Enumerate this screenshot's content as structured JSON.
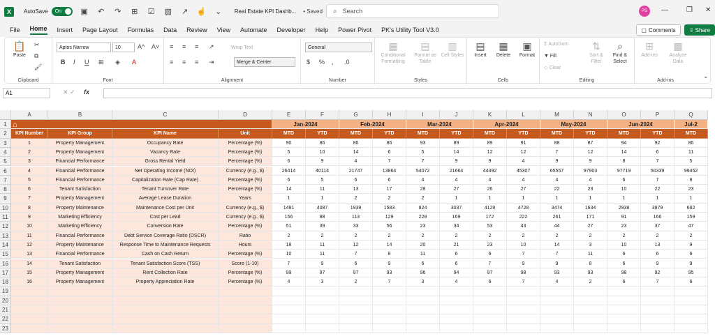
{
  "titlebar": {
    "autosave_label": "AutoSave",
    "autosave_state": "On",
    "file_title": "Real Estate KPI Dashb...",
    "saved_label": "• Saved",
    "search_placeholder": "Search",
    "avatar_initials": "PS"
  },
  "menu": {
    "items": [
      "File",
      "Home",
      "Insert",
      "Page Layout",
      "Formulas",
      "Data",
      "Review",
      "View",
      "Automate",
      "Developer",
      "Help",
      "Power Pivot",
      "PK's Utility Tool V3.0"
    ],
    "active": "Home",
    "comments_label": "Comments",
    "share_label": "Share"
  },
  "ribbon": {
    "clipboard": {
      "label": "Clipboard",
      "paste": "Paste"
    },
    "font": {
      "label": "Font",
      "name": "Aptos Narrow",
      "size": "10"
    },
    "alignment": {
      "label": "Alignment",
      "wrap": "Wrap Text",
      "merge": "Merge & Center"
    },
    "number": {
      "label": "Number",
      "format": "General"
    },
    "styles": {
      "label": "Styles",
      "conditional": "Conditional Formatting",
      "format_table": "Format as Table",
      "cell_styles": "Cell Styles"
    },
    "cells": {
      "label": "Cells",
      "insert": "Insert",
      "delete": "Delete",
      "format": "Format"
    },
    "editing": {
      "label": "Editing",
      "autosum": "AutoSum",
      "fill": "Fill",
      "clear": "Clear",
      "sort": "Sort & Filter",
      "find": "Find & Select"
    },
    "addins": {
      "label": "Add-ins",
      "addins": "Add-ins",
      "analyze": "Analyze Data"
    }
  },
  "formula_bar": {
    "cell_ref": "A1",
    "fx": "fx",
    "content": ""
  },
  "grid": {
    "column_letters": [
      "A",
      "B",
      "C",
      "D",
      "E",
      "F",
      "G",
      "H",
      "I",
      "J",
      "K",
      "L",
      "M",
      "N",
      "O",
      "P",
      "Q"
    ],
    "row_numbers": [
      "1",
      "2",
      "3",
      "4",
      "5",
      "6",
      "7",
      "8",
      "9",
      "10",
      "11",
      "12",
      "13",
      "14",
      "15",
      "16",
      "17",
      "18",
      "19",
      "20",
      "21",
      "22",
      "23"
    ],
    "months": [
      "Jan-2024",
      "Feb-2024",
      "Mar-2024",
      "Apr-2024",
      "May-2024",
      "Jun-2024",
      "Jul-2"
    ],
    "headers": [
      "KPI Number",
      "KPI Group",
      "KPI Name",
      "Unit"
    ],
    "sub_headers": [
      "MTD",
      "YTD"
    ],
    "rows": [
      [
        "1",
        "Property Management",
        "Occupancy Rate",
        "Percentage (%)",
        "90",
        "86",
        "86",
        "86",
        "93",
        "89",
        "89",
        "91",
        "88",
        "87",
        "94",
        "92",
        "86"
      ],
      [
        "2",
        "Property Management",
        "Vacancy Rate",
        "Percentage (%)",
        "5",
        "10",
        "14",
        "6",
        "5",
        "14",
        "12",
        "12",
        "7",
        "12",
        "14",
        "6",
        "11"
      ],
      [
        "3",
        "Financial Performance",
        "Gross Rental Yield",
        "Percentage (%)",
        "6",
        "9",
        "4",
        "7",
        "7",
        "9",
        "9",
        "4",
        "9",
        "9",
        "8",
        "7",
        "5"
      ],
      [
        "4",
        "Financial Performance",
        "Net Operating Income (NOI)",
        "Currency (e.g., $)",
        "26414",
        "40114",
        "21747",
        "13864",
        "54072",
        "21664",
        "44392",
        "45307",
        "65557",
        "97903",
        "97719",
        "50339",
        "99452"
      ],
      [
        "5",
        "Financial Performance",
        "Capitalization Rate (Cap Rate)",
        "Percentage (%)",
        "6",
        "5",
        "6",
        "6",
        "4",
        "4",
        "4",
        "4",
        "4",
        "4",
        "6",
        "7",
        "8"
      ],
      [
        "6",
        "Tenant Satisfaction",
        "Tenant Turnover Rate",
        "Percentage (%)",
        "14",
        "11",
        "13",
        "17",
        "28",
        "27",
        "26",
        "27",
        "22",
        "23",
        "10",
        "22",
        "23"
      ],
      [
        "7",
        "Property Management",
        "Average Lease Duration",
        "Years",
        "1",
        "1",
        "2",
        "2",
        "2",
        "1",
        "1",
        "1",
        "1",
        "1",
        "1",
        "1",
        "1"
      ],
      [
        "8",
        "Property Maintenance",
        "Maintenance Cost per Unit",
        "Currency (e.g., $)",
        "1491",
        "4087",
        "1939",
        "1583",
        "824",
        "3037",
        "4129",
        "4728",
        "3474",
        "1634",
        "2938",
        "3879",
        "682"
      ],
      [
        "9",
        "Marketing Efficiency",
        "Cost per Lead",
        "Currency (e.g., $)",
        "156",
        "88",
        "113",
        "129",
        "228",
        "169",
        "172",
        "222",
        "261",
        "171",
        "91",
        "166",
        "159"
      ],
      [
        "10",
        "Marketing Efficiency",
        "Conversion Rate",
        "Percentage (%)",
        "51",
        "39",
        "33",
        "56",
        "23",
        "34",
        "53",
        "43",
        "44",
        "27",
        "23",
        "37",
        "47"
      ],
      [
        "11",
        "Financial Performance",
        "Debt Service Coverage Ratio (DSCR)",
        "Ratio",
        "2",
        "2",
        "2",
        "2",
        "2",
        "2",
        "2",
        "2",
        "2",
        "2",
        "2",
        "2",
        "2"
      ],
      [
        "12",
        "Property Maintenance",
        "Response Time to Maintenance Requests",
        "Hours",
        "18",
        "11",
        "12",
        "14",
        "20",
        "21",
        "23",
        "10",
        "14",
        "3",
        "10",
        "13",
        "9"
      ],
      [
        "13",
        "Financial Performance",
        "Cash on Cash Return",
        "Percentage (%)",
        "10",
        "11",
        "7",
        "8",
        "11",
        "6",
        "6",
        "7",
        "7",
        "11",
        "6",
        "6",
        "6"
      ],
      [
        "14",
        "Tenant Satisfaction",
        "Tenant Satisfaction Score (TSS)",
        "Score (1-10)",
        "7",
        "9",
        "6",
        "9",
        "6",
        "6",
        "7",
        "9",
        "9",
        "8",
        "6",
        "9",
        "9"
      ],
      [
        "15",
        "Property Management",
        "Rent Collection Rate",
        "Percentage (%)",
        "99",
        "97",
        "97",
        "93",
        "96",
        "94",
        "97",
        "98",
        "93",
        "93",
        "98",
        "92",
        "95"
      ],
      [
        "16",
        "Property Management",
        "Property Appreciation Rate",
        "Percentage (%)",
        "4",
        "3",
        "2",
        "7",
        "3",
        "4",
        "6",
        "7",
        "4",
        "2",
        "6",
        "7",
        "6"
      ]
    ]
  }
}
